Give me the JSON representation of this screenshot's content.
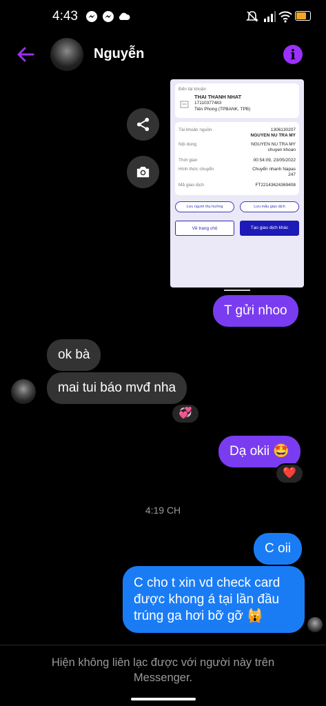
{
  "status_bar": {
    "time": "4:43",
    "battery_level": 0.8
  },
  "header": {
    "contact_name": "Nguyễn",
    "back_icon": "arrow-left-icon",
    "info_icon": "info-icon",
    "accent_color": "#9b30ff"
  },
  "actions": {
    "share_icon": "share-icon",
    "camera_icon": "camera-icon"
  },
  "shared_image": {
    "recipient_label": "Đến tài khoản",
    "recipient_name": "THAI THANH NHAT",
    "recipient_account": "17110377483",
    "recipient_bank": "Tiên Phong (TPBANK, TPB)",
    "rows": [
      {
        "label": "Tài khoản nguồn",
        "value": "1306130207",
        "value2": "NGUYEN NU TRA MY"
      },
      {
        "label": "Nội dung",
        "value": "NGUYEN NU TRA MY",
        "value2": "chuyen khoan"
      },
      {
        "label": "Thời gian",
        "value": "00:54:09, 23/05/2022",
        "value2": ""
      },
      {
        "label": "Hình thức chuyển",
        "value": "Chuyển nhanh Napas",
        "value2": "247"
      },
      {
        "label": "Mã giao dịch",
        "value": "FT22143624369408",
        "value2": ""
      }
    ],
    "save_recipient": "Lưu người thụ hưởng",
    "save_template": "Lưu mẫu giao dịch",
    "home_button": "Về trang chủ",
    "new_transaction_button": "Tạo giao dịch khác"
  },
  "messages": [
    {
      "id": "m1",
      "direction": "out",
      "text": "T gửi nhoo"
    },
    {
      "id": "m2",
      "direction": "in",
      "text": "ok bà"
    },
    {
      "id": "m3",
      "direction": "in",
      "text": "mai tui báo mvđ nha",
      "reaction": "💞"
    },
    {
      "id": "m4",
      "direction": "out",
      "text": "Dạ okii 🤩",
      "reaction": "❤️"
    },
    {
      "id": "m5",
      "direction": "out",
      "text": "C oii"
    },
    {
      "id": "m6",
      "direction": "out",
      "lines": [
        "C cho t xin vd check card",
        "được khong á tại lần đầu",
        "trúng ga hơi bỡ gỡ 🙀"
      ]
    }
  ],
  "timestamp": "4:19 CH",
  "footer": {
    "note": "Hiện không liên lạc được với người này trên Messenger."
  },
  "colors": {
    "outgoing_purple": "#7a3cf0",
    "outgoing_blue": "#1a7cf5",
    "incoming": "#333333"
  }
}
